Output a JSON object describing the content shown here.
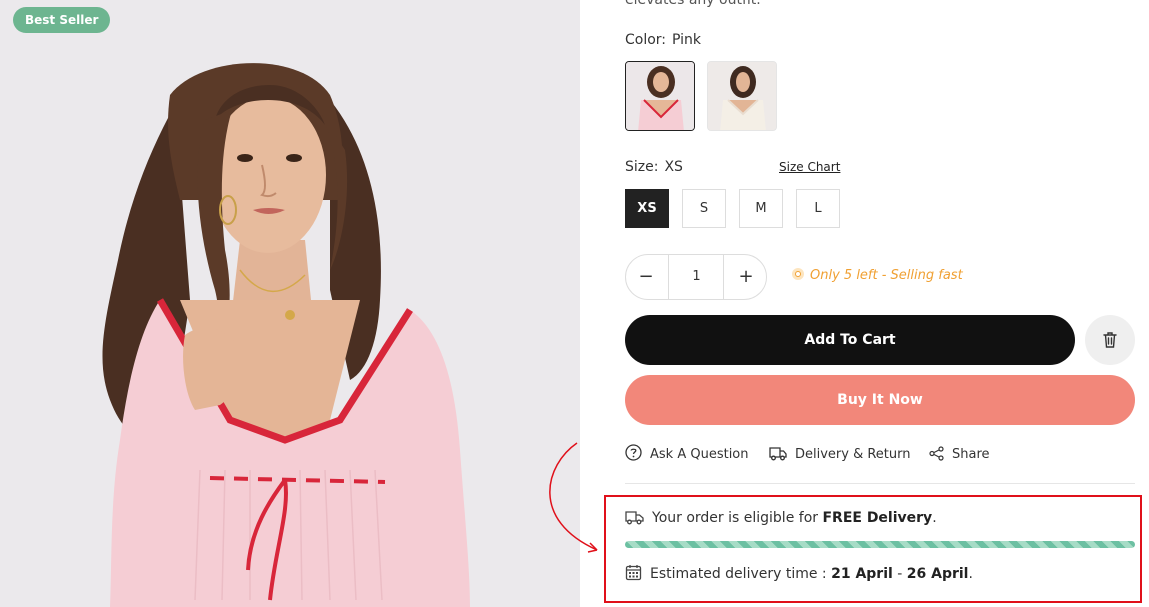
{
  "product": {
    "badge": "Best Seller",
    "description_tail": "elevates any outfit."
  },
  "color": {
    "label": "Color:",
    "value": "Pink",
    "swatches": [
      {
        "name": "Pink",
        "selected": true
      },
      {
        "name": "White",
        "selected": false
      }
    ]
  },
  "size": {
    "label": "Size:",
    "value": "XS",
    "chart_link": "Size Chart",
    "options": [
      "XS",
      "S",
      "M",
      "L"
    ],
    "selected": "XS"
  },
  "quantity": {
    "minus": "−",
    "value": "1",
    "plus": "+"
  },
  "stock": {
    "message": "Only 5 left - Selling fast"
  },
  "buttons": {
    "add_to_cart": "Add To Cart",
    "buy_now": "Buy It Now"
  },
  "links": {
    "ask": "Ask A Question",
    "delivery": "Delivery & Return",
    "share": "Share"
  },
  "delivery": {
    "free_prefix": "Your order is eligible for ",
    "free_strong": "FREE Delivery",
    "free_suffix": ".",
    "progress": 1.0,
    "eta_prefix": "Estimated delivery time : ",
    "eta_start": "21 April",
    "eta_sep": " - ",
    "eta_end": "26 April",
    "eta_suffix": "."
  },
  "colors": {
    "accent_dark": "#111111",
    "buy_now": "#f2877a",
    "badge": "#6db590",
    "stock": "#f0a032",
    "highlight": "#e0101a"
  }
}
